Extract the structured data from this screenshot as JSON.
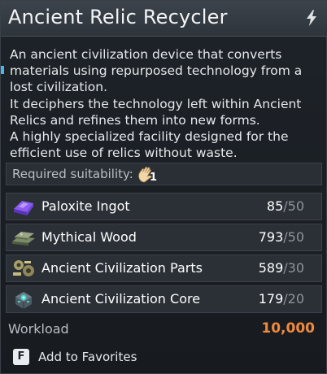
{
  "window": {
    "title": "Ancient Relic Recycler"
  },
  "description": {
    "lines": [
      "An ancient civilization device that converts",
      "materials using repurposed technology from a",
      "lost civilization.",
      "It deciphers the technology left within Ancient",
      "Relics and refines them into new forms.",
      "A highly specialized facility designed for the",
      "efficient use of relics without waste."
    ]
  },
  "suitability": {
    "label": "Required suitability:",
    "icon": "hand-work-icon",
    "level": "1"
  },
  "materials": [
    {
      "name": "Paloxite Ingot",
      "have": "85",
      "need": "50",
      "icon": "purple-ingot-icon"
    },
    {
      "name": "Mythical Wood",
      "have": "793",
      "need": "50",
      "icon": "wood-planks-icon"
    },
    {
      "name": "Ancient Civilization Parts",
      "have": "589",
      "need": "30",
      "icon": "gear-parts-icon"
    },
    {
      "name": "Ancient Civilization Core",
      "have": "179",
      "need": "20",
      "icon": "core-device-icon"
    }
  ],
  "workload": {
    "label": "Workload",
    "value": "10,000"
  },
  "favorite": {
    "key": "F",
    "label": "Add to Favorites"
  },
  "colors": {
    "accent_blue": "#49b4f0",
    "workload_orange": "#f08a3c"
  }
}
